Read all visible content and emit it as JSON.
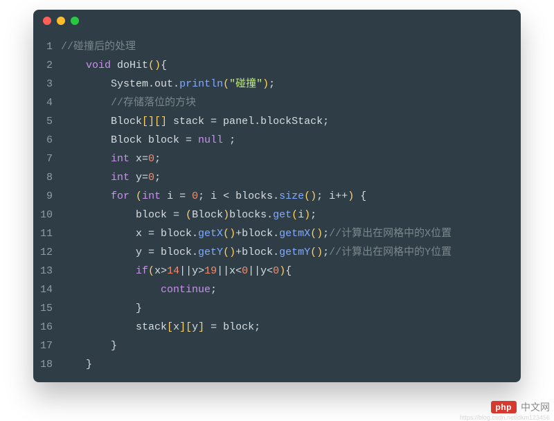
{
  "window": {
    "dots": [
      "red",
      "yellow",
      "green"
    ]
  },
  "code": {
    "lines": [
      {
        "n": "1",
        "i": 0,
        "tokens": [
          [
            "comment",
            "//碰撞后的处理"
          ]
        ]
      },
      {
        "n": "2",
        "i": 1,
        "tokens": [
          [
            "keyword",
            "void"
          ],
          [
            "plain",
            " doHit"
          ],
          [
            "paren",
            "()"
          ],
          [
            "plain",
            "{"
          ]
        ]
      },
      {
        "n": "3",
        "i": 2,
        "tokens": [
          [
            "plain",
            "System."
          ],
          [
            "plain",
            "out"
          ],
          [
            "plain",
            "."
          ],
          [
            "method",
            "println"
          ],
          [
            "paren",
            "("
          ],
          [
            "string",
            "\"碰撞\""
          ],
          [
            "paren",
            ")"
          ],
          [
            "plain",
            ";"
          ]
        ]
      },
      {
        "n": "4",
        "i": 2,
        "tokens": [
          [
            "comment",
            "//存储落位的方块"
          ]
        ]
      },
      {
        "n": "5",
        "i": 2,
        "tokens": [
          [
            "plain",
            "Block"
          ],
          [
            "paren",
            "[][]"
          ],
          [
            "plain",
            " stack = panel.blockStack;"
          ]
        ]
      },
      {
        "n": "6",
        "i": 2,
        "tokens": [
          [
            "plain",
            "Block block = "
          ],
          [
            "null",
            "null"
          ],
          [
            "plain",
            " ;"
          ]
        ]
      },
      {
        "n": "7",
        "i": 2,
        "tokens": [
          [
            "keyword",
            "int"
          ],
          [
            "plain",
            " x="
          ],
          [
            "number",
            "0"
          ],
          [
            "plain",
            ";"
          ]
        ]
      },
      {
        "n": "8",
        "i": 2,
        "tokens": [
          [
            "keyword",
            "int"
          ],
          [
            "plain",
            " y="
          ],
          [
            "number",
            "0"
          ],
          [
            "plain",
            ";"
          ]
        ]
      },
      {
        "n": "9",
        "i": 2,
        "tokens": [
          [
            "keyword",
            "for"
          ],
          [
            "plain",
            " "
          ],
          [
            "paren",
            "("
          ],
          [
            "keyword",
            "int"
          ],
          [
            "plain",
            " i = "
          ],
          [
            "number",
            "0"
          ],
          [
            "plain",
            "; i < blocks."
          ],
          [
            "method",
            "size"
          ],
          [
            "paren",
            "()"
          ],
          [
            "plain",
            "; i++"
          ],
          [
            "paren",
            ")"
          ],
          [
            "plain",
            " {"
          ]
        ]
      },
      {
        "n": "10",
        "i": 3,
        "tokens": [
          [
            "plain",
            "block = "
          ],
          [
            "paren",
            "("
          ],
          [
            "plain",
            "Block"
          ],
          [
            "paren",
            ")"
          ],
          [
            "plain",
            "blocks."
          ],
          [
            "method",
            "get"
          ],
          [
            "paren",
            "("
          ],
          [
            "plain",
            "i"
          ],
          [
            "paren",
            ")"
          ],
          [
            "plain",
            ";"
          ]
        ]
      },
      {
        "n": "11",
        "i": 3,
        "tokens": [
          [
            "plain",
            "x = block."
          ],
          [
            "method",
            "getX"
          ],
          [
            "paren",
            "()"
          ],
          [
            "plain",
            "+block."
          ],
          [
            "method",
            "getmX"
          ],
          [
            "paren",
            "()"
          ],
          [
            "plain",
            ";"
          ],
          [
            "comment",
            "//计算出在网格中的X位置"
          ]
        ]
      },
      {
        "n": "12",
        "i": 3,
        "tokens": [
          [
            "plain",
            "y = block."
          ],
          [
            "method",
            "getY"
          ],
          [
            "paren",
            "()"
          ],
          [
            "plain",
            "+block."
          ],
          [
            "method",
            "getmY"
          ],
          [
            "paren",
            "()"
          ],
          [
            "plain",
            ";"
          ],
          [
            "comment",
            "//计算出在网格中的Y位置"
          ]
        ]
      },
      {
        "n": "13",
        "i": 3,
        "tokens": [
          [
            "keyword",
            "if"
          ],
          [
            "paren",
            "("
          ],
          [
            "plain",
            "x>"
          ],
          [
            "number",
            "14"
          ],
          [
            "plain",
            "||y>"
          ],
          [
            "number",
            "19"
          ],
          [
            "plain",
            "||x<"
          ],
          [
            "number",
            "0"
          ],
          [
            "plain",
            "||y<"
          ],
          [
            "number",
            "0"
          ],
          [
            "paren",
            ")"
          ],
          [
            "plain",
            "{"
          ]
        ]
      },
      {
        "n": "14",
        "i": 4,
        "tokens": [
          [
            "keyword",
            "continue"
          ],
          [
            "plain",
            ";"
          ]
        ]
      },
      {
        "n": "15",
        "i": 3,
        "tokens": [
          [
            "plain",
            "}"
          ]
        ]
      },
      {
        "n": "16",
        "i": 3,
        "tokens": [
          [
            "plain",
            "stack"
          ],
          [
            "paren",
            "["
          ],
          [
            "plain",
            "x"
          ],
          [
            "paren",
            "]["
          ],
          [
            "plain",
            "y"
          ],
          [
            "paren",
            "]"
          ],
          [
            "plain",
            " = block;"
          ]
        ]
      },
      {
        "n": "17",
        "i": 2,
        "tokens": [
          [
            "plain",
            "}"
          ]
        ]
      },
      {
        "n": "18",
        "i": 1,
        "tokens": [
          [
            "plain",
            "}"
          ]
        ]
      }
    ]
  },
  "watermark": {
    "logo": "php",
    "text": "中文网",
    "url": "https://blog.csdn.net/dkm123456"
  }
}
